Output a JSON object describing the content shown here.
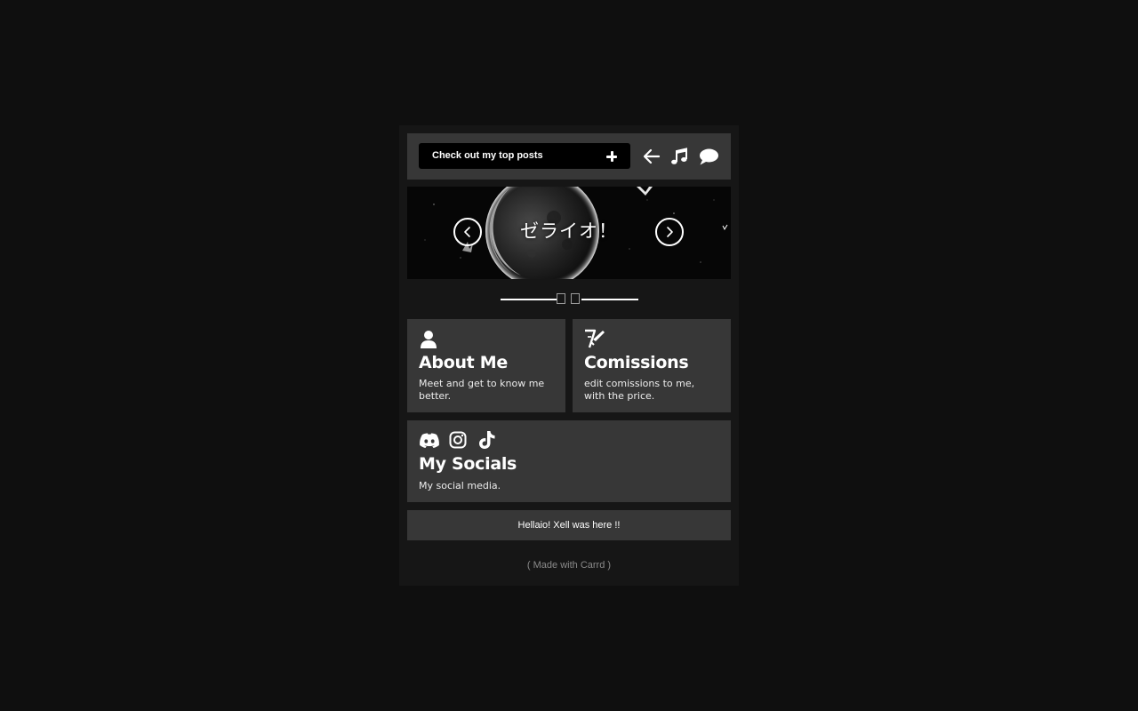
{
  "header": {
    "top_posts_label": "Check out my top posts",
    "icons": [
      "plus-icon",
      "arrow-left-icon",
      "music-note-icon",
      "chat-bubble-icon"
    ]
  },
  "banner": {
    "title": "ゼライオ！",
    "prev_icon": "chevron-left-icon",
    "next_icon": "chevron-right-icon"
  },
  "cards": {
    "about": {
      "icon": "user-icon",
      "title": "About Me",
      "description": "Meet and get to know me better."
    },
    "commissions": {
      "icon": "brush-icon",
      "title": "Comissions",
      "description": "edit comissions to me, with the price."
    },
    "socials": {
      "icons": [
        "discord-icon",
        "instagram-icon",
        "tiktok-icon"
      ],
      "title": "My Socials",
      "description": "My social media."
    }
  },
  "footer": {
    "note": "Hellaio! Xell was here !!",
    "made_with": "( Made with Carrd )"
  },
  "colors": {
    "background": "#0f0f0f",
    "page": "#161616",
    "panel": "#373737",
    "button": "#000000",
    "text": "#ffffff",
    "muted": "#8a8a8a"
  }
}
